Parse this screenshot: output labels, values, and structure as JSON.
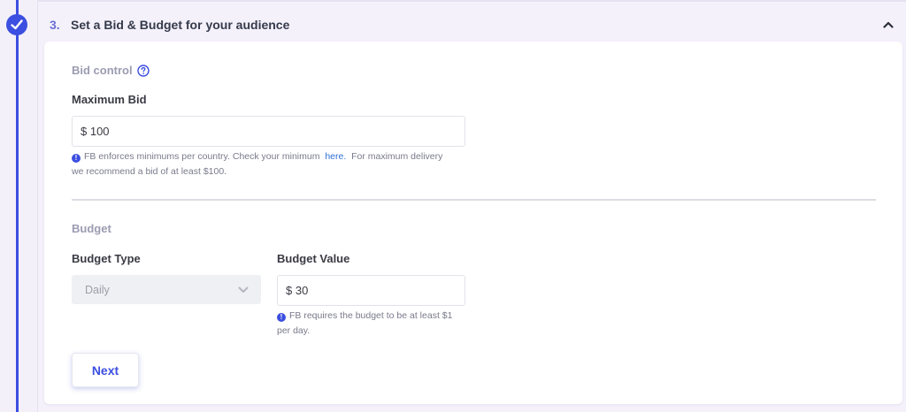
{
  "step": {
    "number": "3.",
    "title": "Set a Bid & Budget for your audience",
    "completed": true
  },
  "bid_control": {
    "label": "Bid control",
    "maximum_bid_label": "Maximum Bid",
    "maximum_bid_value": "$ 100",
    "hint_before_link": "FB enforces minimums per country. Check your minimum",
    "hint_link": "here.",
    "hint_after_link": "For maximum delivery",
    "hint_line2": "we recommend a bid of at least $100."
  },
  "budget": {
    "label": "Budget",
    "type_label": "Budget Type",
    "type_value": "Daily",
    "value_label": "Budget Value",
    "value": "$ 30",
    "hint_line1": "FB requires the budget to be at least $1",
    "hint_line2": "per day."
  },
  "actions": {
    "next_label": "Next"
  },
  "icons": {
    "step_status": "check-circle-icon",
    "collapse": "chevron-up-icon",
    "help": "question-circle-icon",
    "info": "info-circle-icon",
    "select_arrow": "chevron-down-icon"
  },
  "colors": {
    "accent": "#3c4fe0",
    "link": "#2f6fd8",
    "page_background": "#f3f0fa"
  }
}
